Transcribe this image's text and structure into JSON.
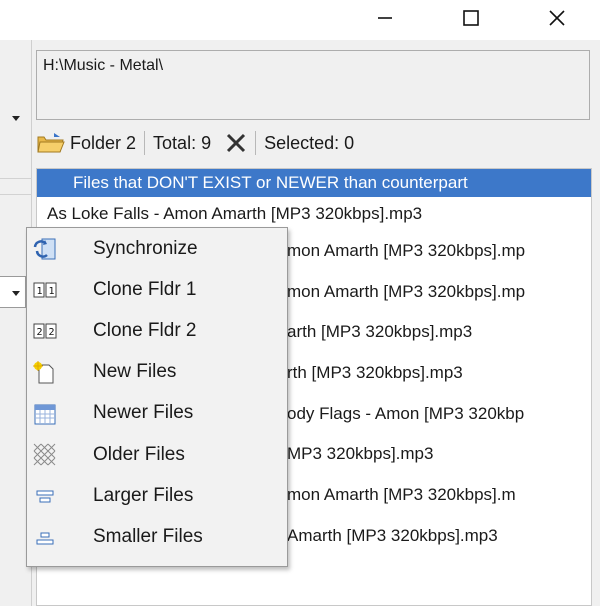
{
  "window": {
    "controls": {
      "minimize": "minimize-icon",
      "maximize": "maximize-icon",
      "close": "close-icon"
    }
  },
  "path": "H:\\Music - Metal\\",
  "toolbar": {
    "folder_label": "Folder 2",
    "total_label": "Total: 9",
    "selected_label": "Selected: 0"
  },
  "file_list": {
    "header": "Files that DON'T EXIST or NEWER than counterpart",
    "rows": [
      "As Loke Falls - Amon Amarth [MP3 320kbps].mp3",
      "mon Amarth [MP3 320kbps].mp",
      "mon Amarth [MP3 320kbps].mp",
      "arth [MP3 320kbps].mp3",
      "rth [MP3 320kbps].mp3",
      "ody Flags - Amon [MP3 320kbp",
      "MP3 320kbps].mp3",
      "mon Amarth [MP3 320kbps].m",
      "Amarth [MP3 320kbps].mp3"
    ]
  },
  "context_menu": {
    "items": [
      {
        "label": "Synchronize",
        "icon": "sync-icon"
      },
      {
        "label": "Clone Fldr 1",
        "icon": "clone-folder-1-icon"
      },
      {
        "label": "Clone Fldr 2",
        "icon": "clone-folder-2-icon"
      },
      {
        "label": "New Files",
        "icon": "new-file-icon"
      },
      {
        "label": "Newer Files",
        "icon": "calendar-icon"
      },
      {
        "label": "Older Files",
        "icon": "hatch-icon"
      },
      {
        "label": "Larger Files",
        "icon": "larger-icon"
      },
      {
        "label": "Smaller Files",
        "icon": "smaller-icon"
      }
    ]
  },
  "colors": {
    "header_bg": "#3d78c9",
    "menu_bg": "#f2f2f2",
    "pane_bg": "#f0f0f0"
  }
}
